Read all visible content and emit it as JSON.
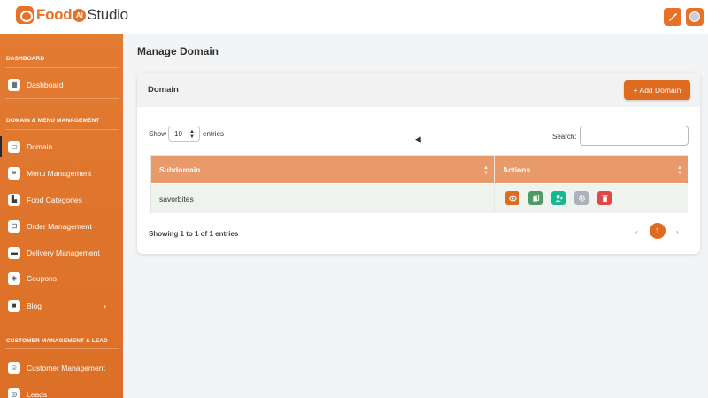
{
  "app": {
    "brand_food": "Food",
    "brand_ai": "AI",
    "brand_studio": "Studio",
    "accent": "#e8712a",
    "sidebar_color": "#de7329"
  },
  "topbar": {
    "tools_icon": "wand-icon",
    "avatar_icon": "user-avatar-icon"
  },
  "sidebar": {
    "sections": [
      {
        "title": "DASHBOARD"
      },
      {
        "title": "DOMAIN & MENU MANAGEMENT"
      },
      {
        "title": "CUSTOMER MANAGEMENT & LEAD"
      }
    ],
    "items": [
      {
        "label": "Dashboard",
        "icon": "grid-icon"
      },
      {
        "label": "Domain",
        "icon": "monitor-icon",
        "active": true
      },
      {
        "label": "Menu Management",
        "icon": "menu-icon"
      },
      {
        "label": "Food Categories",
        "icon": "categories-icon"
      },
      {
        "label": "Order Management",
        "icon": "cart-icon"
      },
      {
        "label": "Delivery Management",
        "icon": "truck-icon"
      },
      {
        "label": "Coupons",
        "icon": "tag-icon"
      },
      {
        "label": "Blog",
        "icon": "blog-icon",
        "has_submenu": true
      },
      {
        "label": "Customer Management",
        "icon": "users-icon"
      },
      {
        "label": "Leads",
        "icon": "target-icon"
      }
    ]
  },
  "main": {
    "page_title": "Manage Domain",
    "card_title": "Domain",
    "add_button": "+ Add Domain",
    "show_label": "Show",
    "entries_value": "10",
    "entries_label": "entries",
    "search_label": "Search:",
    "search_value": "",
    "table": {
      "columns": [
        "Subdomain",
        "Actions"
      ],
      "rows": [
        {
          "subdomain": "savorbites"
        }
      ],
      "actions": [
        {
          "name": "view",
          "icon": "eye-icon",
          "color": "#dd6b20"
        },
        {
          "name": "copy",
          "icon": "copy-icon",
          "color": "#4f9a63"
        },
        {
          "name": "assign-user",
          "icon": "user-plus-icon",
          "color": "#17b890"
        },
        {
          "name": "settings",
          "icon": "gear-icon",
          "color": "#aab3bd"
        },
        {
          "name": "delete",
          "icon": "trash-icon",
          "color": "#e04848"
        }
      ]
    },
    "info_text": "Showing 1 to 1 of 1 entries",
    "pagination": {
      "prev": "‹",
      "current": "1",
      "next": "›"
    }
  }
}
